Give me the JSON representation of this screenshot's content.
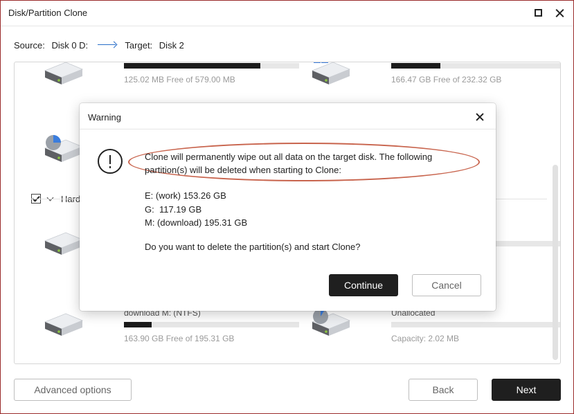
{
  "window": {
    "title": "Disk/Partition Clone"
  },
  "path": {
    "source_label": "Source:",
    "source_value": "Disk 0 D:",
    "target_label": "Target:",
    "target_value": "Disk 2"
  },
  "partitions": {
    "top_left": {
      "capacity": "125.02 MB Free of 579.00 MB",
      "used_fraction": 0.78
    },
    "top_right": {
      "capacity": "166.47 GB Free of 232.32 GB",
      "used_fraction": 0.28
    },
    "bottom_left": {
      "name": "download M: (NTFS)",
      "capacity": "163.90 GB Free of 195.31 GB",
      "used_fraction": 0.16
    },
    "bottom_right": {
      "name": "Unallocated",
      "capacity": "Capacity: 2.02 MB",
      "used_fraction": 0.0
    }
  },
  "hard_disk_row": {
    "label": "Hard",
    "checked": true
  },
  "dialog": {
    "title": "Warning",
    "message": "Clone will permanently wipe out all data on the target disk. The following partition(s) will be deleted when starting to Clone:",
    "partitions": [
      "E: (work) 153.26 GB",
      "G:  117.19 GB",
      "M: (download) 195.31 GB"
    ],
    "question": "Do you want to delete the partition(s) and start Clone?",
    "continue_label": "Continue",
    "cancel_label": "Cancel"
  },
  "footer": {
    "advanced_label": "Advanced options",
    "back_label": "Back",
    "next_label": "Next"
  },
  "colors": {
    "accent": "#2a6fc9",
    "highlight_ring": "#c8644d",
    "dark_button": "#1f1f1f",
    "border": "#9a2a2a"
  }
}
